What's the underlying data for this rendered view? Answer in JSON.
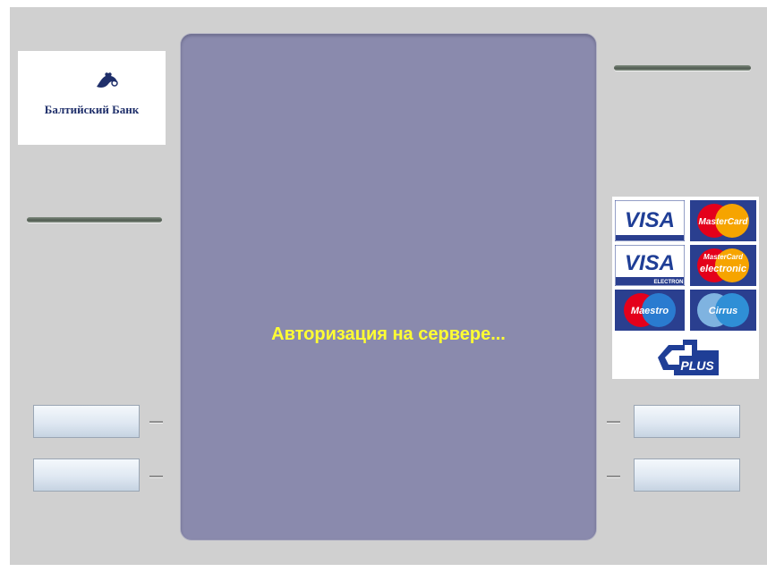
{
  "bank": {
    "name": "Балтийский Банк",
    "logo_icon": "bird-logo-icon"
  },
  "screen": {
    "status_text": "Авторизация на сервере..."
  },
  "colors": {
    "screen": "#8a8aad",
    "status_text": "#ffff33",
    "panel": "#d0d0d0"
  },
  "left_buttons": [
    {
      "label": ""
    },
    {
      "label": ""
    }
  ],
  "right_buttons": [
    {
      "label": ""
    },
    {
      "label": ""
    }
  ],
  "card_logos": {
    "visa": "VISA",
    "mastercard": "MasterCard",
    "visa_electron": "VISA",
    "visa_electron_sub": "ELECTRON",
    "mastercard_electronic_top": "MasterCard",
    "mastercard_electronic": "electronic",
    "maestro": "Maestro",
    "cirrus": "Cirrus",
    "plus": "PLUS"
  }
}
